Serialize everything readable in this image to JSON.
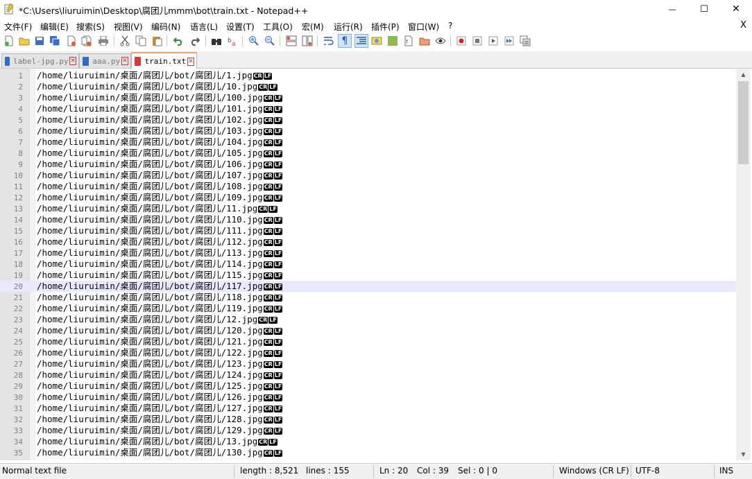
{
  "window": {
    "title": "*C:\\Users\\liuruimin\\Desktop\\腐团儿mmm\\bot\\train.txt - Notepad++",
    "minimize": "—",
    "maximize": "☐",
    "close": "✕"
  },
  "menu": {
    "items": [
      "文件(F)",
      "编辑(E)",
      "搜索(S)",
      "视图(V)",
      "编码(N)",
      "语言(L)",
      "设置(T)",
      "工具(O)",
      "宏(M)",
      "运行(R)",
      "插件(P)",
      "窗口(W)",
      "?"
    ],
    "close_doc": "X"
  },
  "tabs": [
    {
      "label": "label-jpg.py",
      "icon_color": "#2f6fc0"
    },
    {
      "label": "aaa.py",
      "icon_color": "#2f6fc0"
    },
    {
      "label": "train.txt",
      "icon_color": "#d43c3c"
    }
  ],
  "editor": {
    "current_line": 20,
    "eol_cr": "CR",
    "eol_lf": "LF",
    "lines": [
      "/home/liuruimin/桌面/腐团儿/bot/腐团儿/1.jpg",
      "/home/liuruimin/桌面/腐团儿/bot/腐团儿/10.jpg",
      "/home/liuruimin/桌面/腐团儿/bot/腐团儿/100.jpg",
      "/home/liuruimin/桌面/腐团儿/bot/腐团儿/101.jpg",
      "/home/liuruimin/桌面/腐团儿/bot/腐团儿/102.jpg",
      "/home/liuruimin/桌面/腐团儿/bot/腐团儿/103.jpg",
      "/home/liuruimin/桌面/腐团儿/bot/腐团儿/104.jpg",
      "/home/liuruimin/桌面/腐团儿/bot/腐团儿/105.jpg",
      "/home/liuruimin/桌面/腐团儿/bot/腐团儿/106.jpg",
      "/home/liuruimin/桌面/腐团儿/bot/腐团儿/107.jpg",
      "/home/liuruimin/桌面/腐团儿/bot/腐团儿/108.jpg",
      "/home/liuruimin/桌面/腐团儿/bot/腐团儿/109.jpg",
      "/home/liuruimin/桌面/腐团儿/bot/腐团儿/11.jpg",
      "/home/liuruimin/桌面/腐团儿/bot/腐团儿/110.jpg",
      "/home/liuruimin/桌面/腐团儿/bot/腐团儿/111.jpg",
      "/home/liuruimin/桌面/腐团儿/bot/腐团儿/112.jpg",
      "/home/liuruimin/桌面/腐团儿/bot/腐团儿/113.jpg",
      "/home/liuruimin/桌面/腐团儿/bot/腐团儿/114.jpg",
      "/home/liuruimin/桌面/腐团儿/bot/腐团儿/115.jpg",
      "/home/liuruimin/桌面/腐团儿/bot/腐团儿/117.jpg",
      "/home/liuruimin/桌面/腐团儿/bot/腐团儿/118.jpg",
      "/home/liuruimin/桌面/腐团儿/bot/腐团儿/119.jpg",
      "/home/liuruimin/桌面/腐团儿/bot/腐团儿/12.jpg",
      "/home/liuruimin/桌面/腐团儿/bot/腐团儿/120.jpg",
      "/home/liuruimin/桌面/腐团儿/bot/腐团儿/121.jpg",
      "/home/liuruimin/桌面/腐团儿/bot/腐团儿/122.jpg",
      "/home/liuruimin/桌面/腐团儿/bot/腐团儿/123.jpg",
      "/home/liuruimin/桌面/腐团儿/bot/腐团儿/124.jpg",
      "/home/liuruimin/桌面/腐团儿/bot/腐团儿/125.jpg",
      "/home/liuruimin/桌面/腐团儿/bot/腐团儿/126.jpg",
      "/home/liuruimin/桌面/腐团儿/bot/腐团儿/127.jpg",
      "/home/liuruimin/桌面/腐团儿/bot/腐团儿/128.jpg",
      "/home/liuruimin/桌面/腐团儿/bot/腐团儿/129.jpg",
      "/home/liuruimin/桌面/腐团儿/bot/腐团儿/13.jpg",
      "/home/liuruimin/桌面/腐团儿/bot/腐团儿/130.jpg"
    ]
  },
  "status": {
    "file_type": "Normal text file",
    "length": "length : 8,521",
    "lines": "lines : 155",
    "ln": "Ln : 20",
    "col": "Col : 39",
    "sel": "Sel : 0 | 0",
    "eol": "Windows (CR LF)",
    "encoding": "UTF-8",
    "mode": "INS"
  },
  "colors": {
    "current_line": "#e8e8ff",
    "gutter": "#e4e4e4",
    "tab_active_accent": "#f4a460"
  }
}
